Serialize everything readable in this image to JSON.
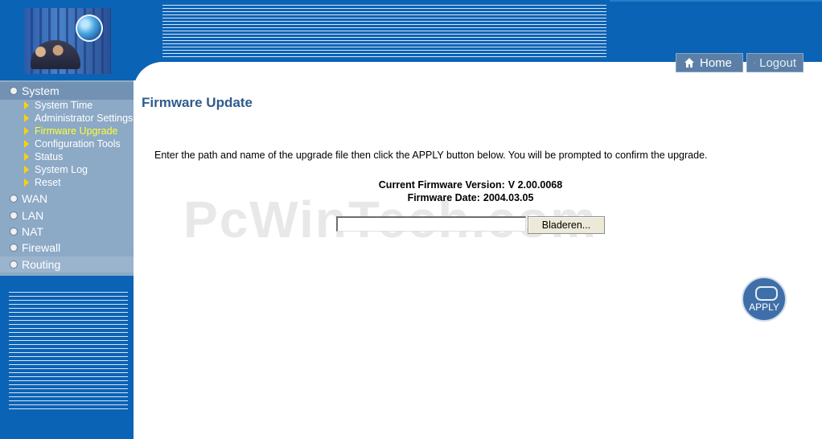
{
  "header": {
    "home_label": "Home",
    "logout_label": "Logout"
  },
  "sidebar": {
    "sections": [
      {
        "label": "System"
      },
      {
        "label": "WAN"
      },
      {
        "label": "LAN"
      },
      {
        "label": "NAT"
      },
      {
        "label": "Firewall"
      },
      {
        "label": "Routing"
      }
    ],
    "system_items": [
      {
        "label": "System Time"
      },
      {
        "label": "Administrator Settings"
      },
      {
        "label": "Firmware Upgrade",
        "active": true
      },
      {
        "label": "Configuration Tools"
      },
      {
        "label": "Status"
      },
      {
        "label": "System Log"
      },
      {
        "label": "Reset"
      }
    ]
  },
  "main": {
    "title": "Firmware Update",
    "instruction": "Enter the path and name of the upgrade file then click the APPLY button below. You will be prompted to confirm the upgrade.",
    "version_label": "Current Firmware Version:",
    "version_value": "V 2.00.0068",
    "date_label": "Firmware Date:",
    "date_value": "2004.03.05",
    "file_input_value": "",
    "browse_label": "Bladeren...",
    "apply_label": "APPLY",
    "watermark": "PcWinTech.com"
  },
  "colors": {
    "header_blue": "#0b63b5",
    "menu_bg": "#8ca9c6",
    "active_item": "#ffff33",
    "title": "#2f5b8d"
  }
}
